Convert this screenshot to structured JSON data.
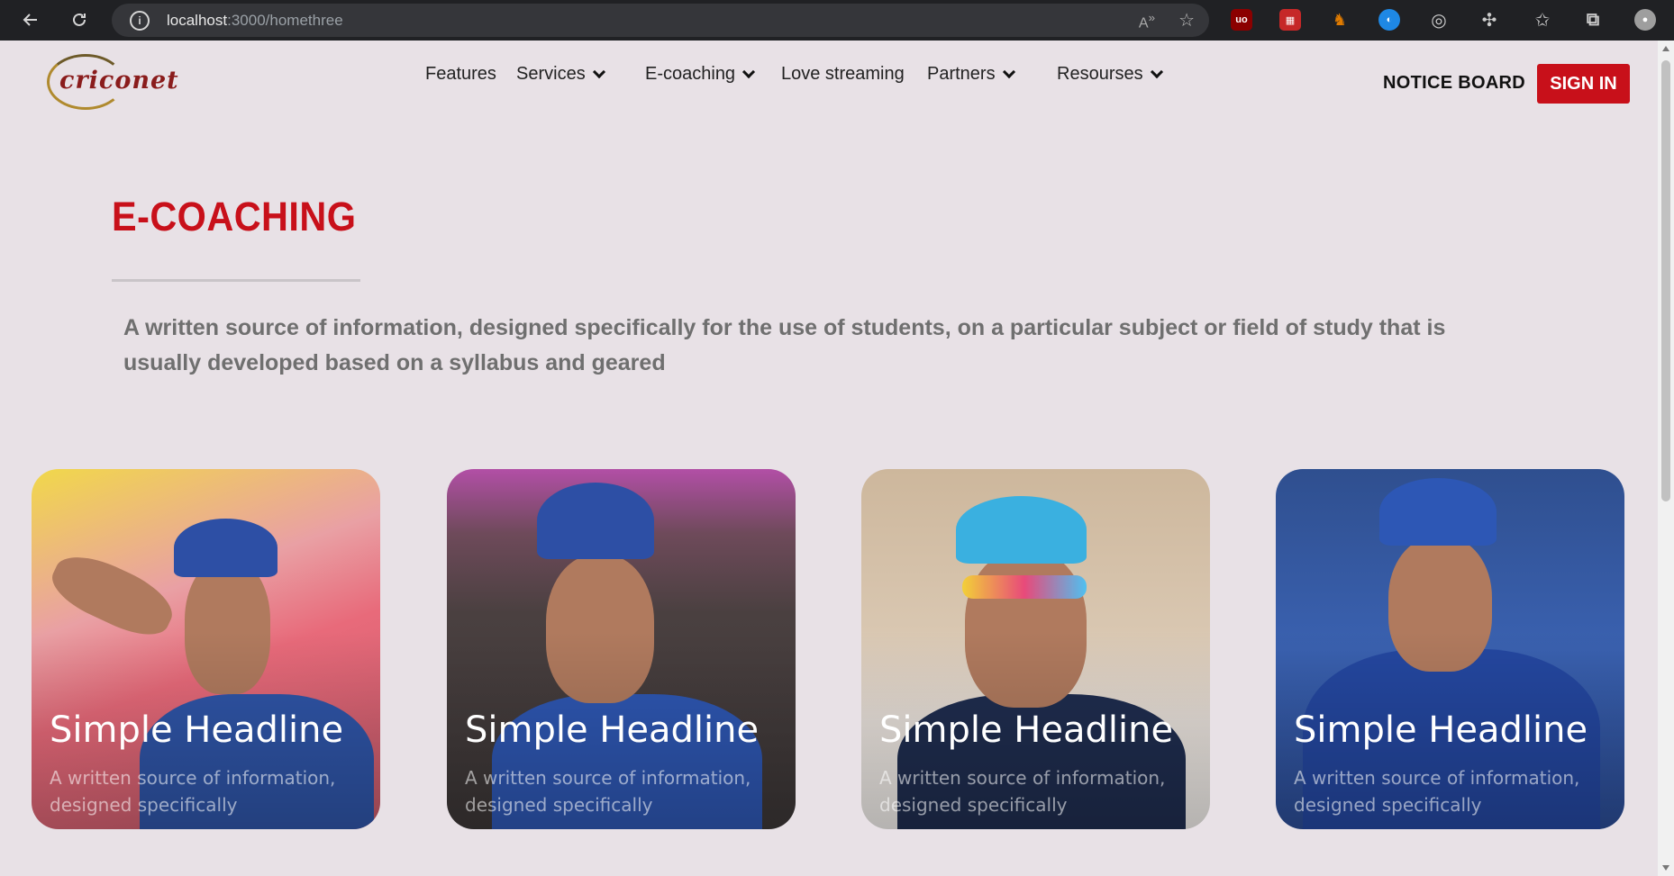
{
  "browser": {
    "url_host": "localhost",
    "url_rest": ":3000/homethree"
  },
  "nav": {
    "logo_text": "criconet",
    "items": [
      {
        "label": "Features",
        "dropdown": false
      },
      {
        "label": "Services",
        "dropdown": true
      },
      {
        "label": "E-coaching",
        "dropdown": true
      },
      {
        "label": "Love streaming",
        "dropdown": false
      },
      {
        "label": "Partners",
        "dropdown": true
      },
      {
        "label": "Resourses",
        "dropdown": true
      }
    ],
    "notice_board": "NOTICE BOARD",
    "sign_in": "SIGN IN"
  },
  "section": {
    "title": "E-COACHING",
    "description": "A written source of information, designed specifically for the use of students, on a particular subject or field of study that is usually developed based on a syllabus and geared"
  },
  "cards": [
    {
      "headline": "Simple Headline",
      "caption": "A written source of information, designed specifically"
    },
    {
      "headline": "Simple Headline",
      "caption": "A written source of information, designed specifically"
    },
    {
      "headline": "Simple Headline",
      "caption": "A written source of information, designed specifically"
    },
    {
      "headline": "Simple Headline",
      "caption": "A written source of information, designed specifically"
    }
  ],
  "colors": {
    "accent": "#c8101a",
    "page_bg": "#e8e1e6"
  }
}
